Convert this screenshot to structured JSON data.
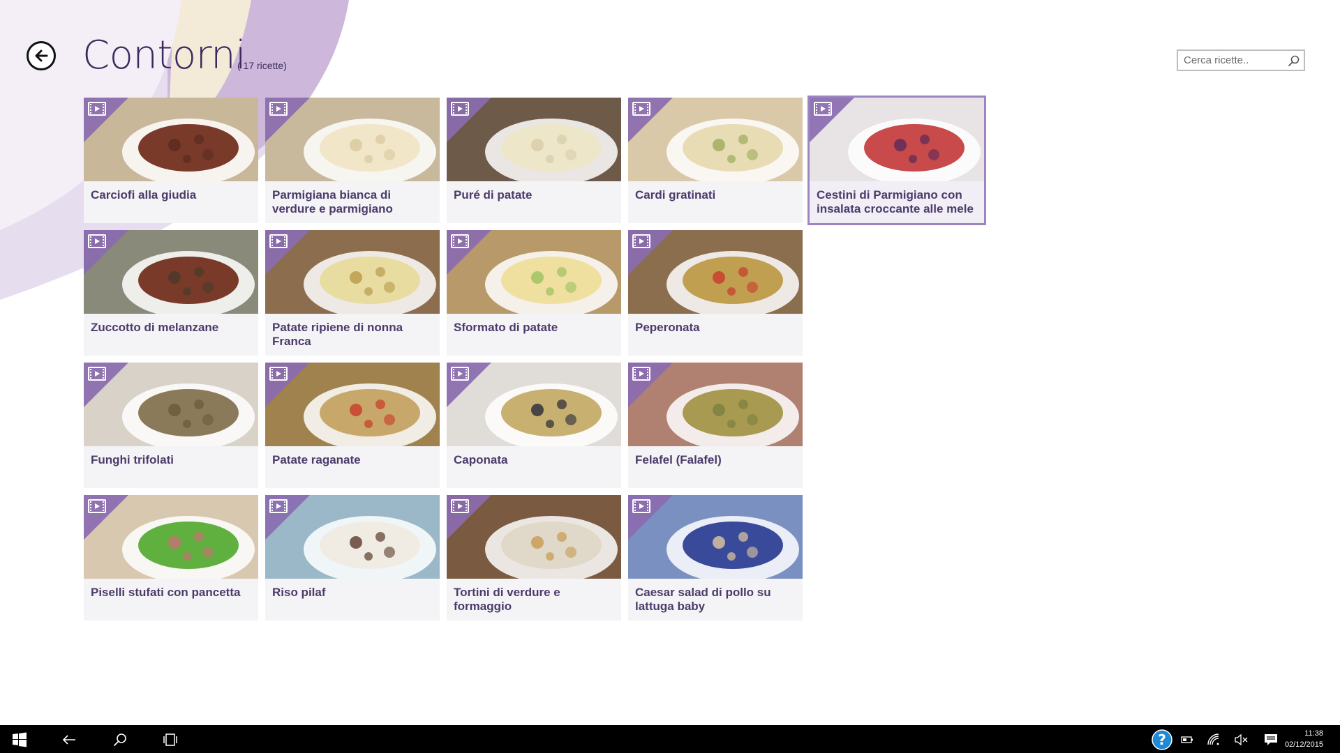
{
  "header": {
    "title": "Contorni",
    "count": "( 17 ricette)",
    "search_placeholder": "Cerca ricette.."
  },
  "icons": {
    "back": "back-arrow-icon",
    "search": "search-icon",
    "video": "video-icon"
  },
  "colors": {
    "accent": "#8a6bb0",
    "title": "#3c2a5e",
    "label": "#4b3b6a"
  },
  "recipes": [
    {
      "label": "Carciofi alla giudia"
    },
    {
      "label": "Parmigiana bianca di verdure e parmigiano"
    },
    {
      "label": "Puré di patate"
    },
    {
      "label": "Cardi gratinati"
    },
    {
      "label": "Cestini di Parmigiano con insalata croccante alle mele",
      "selected": true
    },
    {
      "label": "Zuccotto di melanzane"
    },
    {
      "label": "Patate ripiene di nonna Franca"
    },
    {
      "label": "Sformato di patate"
    },
    {
      "label": "Peperonata"
    },
    {
      "label": "Funghi trifolati"
    },
    {
      "label": "Patate raganate"
    },
    {
      "label": "Caponata"
    },
    {
      "label": "Felafel (Falafel)"
    },
    {
      "label": "Piselli stufati con pancetta"
    },
    {
      "label": "Riso pilaf"
    },
    {
      "label": "Tortini di verdure e formaggio"
    },
    {
      "label": "Caesar salad di pollo su lattuga baby"
    }
  ],
  "taskbar": {
    "time": "11:38",
    "date": "02/12/2015",
    "icons": [
      "windows-start-icon",
      "back-icon",
      "search-icon",
      "task-view-icon",
      "help-icon",
      "battery-icon",
      "wifi-icon",
      "volume-muted-icon",
      "notifications-icon"
    ]
  }
}
